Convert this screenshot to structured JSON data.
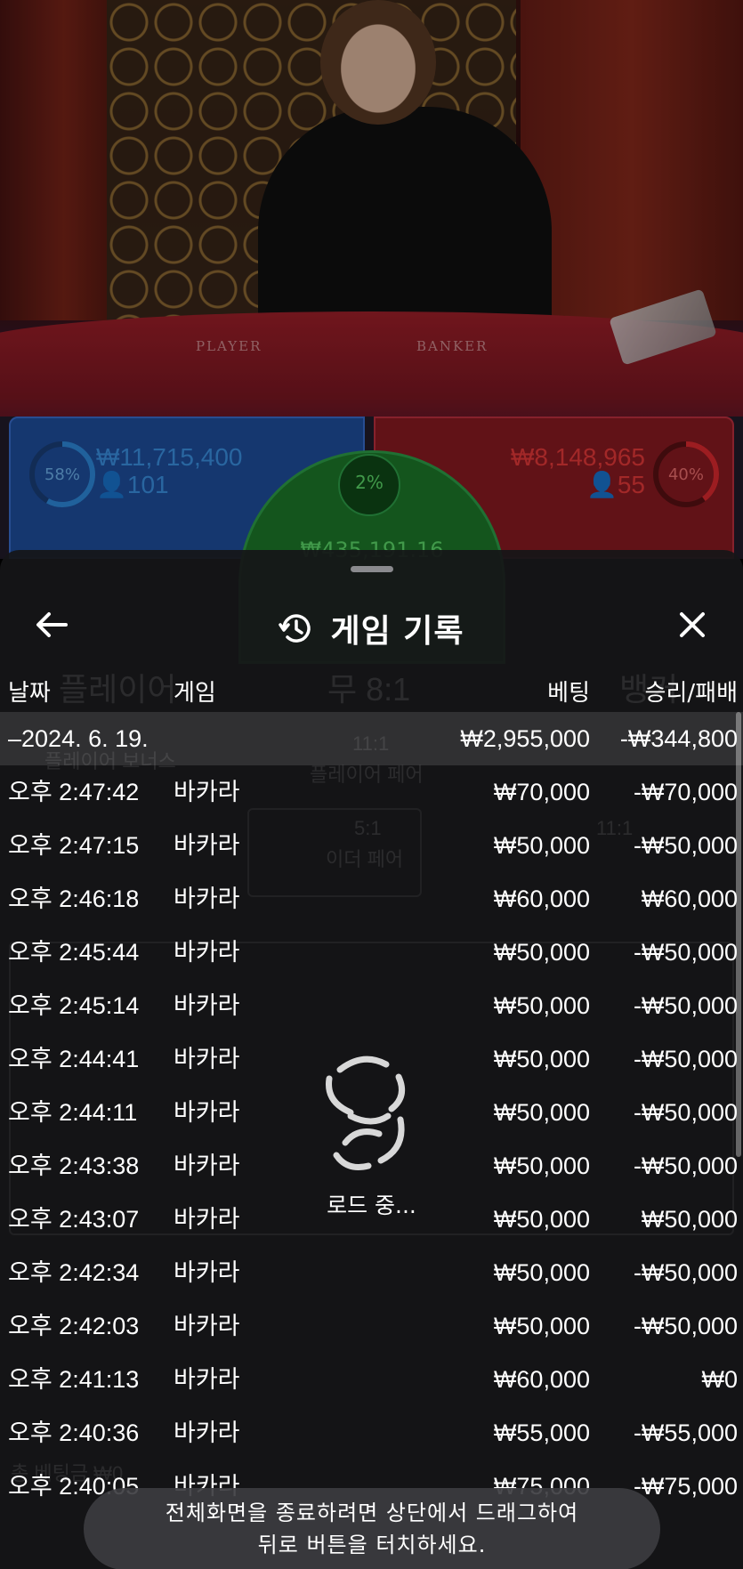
{
  "live_table": {
    "felt_player_label": "PLAYER",
    "felt_banker_label": "BANKER",
    "player": {
      "percent": "58%",
      "percent_value": 58,
      "amount": "₩11,715,400",
      "count": "101"
    },
    "banker": {
      "percent": "40%",
      "percent_value": 40,
      "amount": "₩8,148,965",
      "count": "55"
    },
    "tie": {
      "percent": "2%",
      "amount": "₩435,191.16"
    },
    "colors": {
      "player": "#1f4fa0",
      "banker": "#8c1a22",
      "tie": "#1d7a2a"
    }
  },
  "sheet": {
    "title": "게임 기록",
    "icons": {
      "back": "arrow-left-icon",
      "history": "history-clock-icon",
      "close": "close-icon"
    },
    "columns": {
      "date": "날짜",
      "game": "게임",
      "bet": "베팅",
      "result": "승리/패배"
    },
    "summary": {
      "date": "–2024. 6. 19.",
      "bet": "₩2,955,000",
      "result": "-₩344,800"
    },
    "rows": [
      {
        "time": "오후 2:47:42",
        "game": "바카라",
        "bet": "₩70,000",
        "result": "-₩70,000"
      },
      {
        "time": "오후 2:47:15",
        "game": "바카라",
        "bet": "₩50,000",
        "result": "-₩50,000"
      },
      {
        "time": "오후 2:46:18",
        "game": "바카라",
        "bet": "₩60,000",
        "result": "₩60,000"
      },
      {
        "time": "오후 2:45:44",
        "game": "바카라",
        "bet": "₩50,000",
        "result": "-₩50,000"
      },
      {
        "time": "오후 2:45:14",
        "game": "바카라",
        "bet": "₩50,000",
        "result": "-₩50,000"
      },
      {
        "time": "오후 2:44:41",
        "game": "바카라",
        "bet": "₩50,000",
        "result": "-₩50,000"
      },
      {
        "time": "오후 2:44:11",
        "game": "바카라",
        "bet": "₩50,000",
        "result": "-₩50,000"
      },
      {
        "time": "오후 2:43:38",
        "game": "바카라",
        "bet": "₩50,000",
        "result": "-₩50,000"
      },
      {
        "time": "오후 2:43:07",
        "game": "바카라",
        "bet": "₩50,000",
        "result": "₩50,000"
      },
      {
        "time": "오후 2:42:34",
        "game": "바카라",
        "bet": "₩50,000",
        "result": "-₩50,000"
      },
      {
        "time": "오후 2:42:03",
        "game": "바카라",
        "bet": "₩50,000",
        "result": "-₩50,000"
      },
      {
        "time": "오후 2:41:13",
        "game": "바카라",
        "bet": "₩60,000",
        "result": "₩0"
      },
      {
        "time": "오후 2:40:36",
        "game": "바카라",
        "bet": "₩55,000",
        "result": "-₩55,000"
      },
      {
        "time": "오후 2:40:05",
        "game": "바카라",
        "bet": "₩75,000",
        "result": "-₩75,000"
      }
    ],
    "loading_text": "로드 중..."
  },
  "background_ui": {
    "player_label": "플레이어",
    "tie_label": "무 8:1",
    "banker_label": "뱅커",
    "player_bonus": "플레이어 보너스",
    "player_pair": "11:1",
    "player_pair_label": "플레이어 페어",
    "either_pair": "5:1",
    "either_pair_label": "이더 페어",
    "banker_pair": "11:1",
    "total_bet": "총 베팅금 ₩0"
  },
  "toast": {
    "line1": "전체화면을 종료하려면 상단에서 드래그하여",
    "line2": "뒤로 버튼을 터치하세요."
  }
}
